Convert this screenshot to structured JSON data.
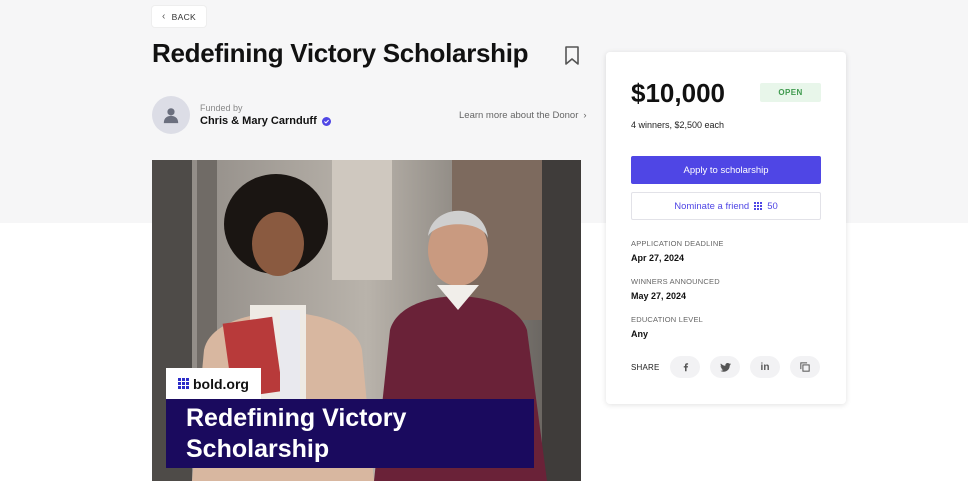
{
  "nav": {
    "back_label": "BACK"
  },
  "header": {
    "title": "Redefining Victory Scholarship"
  },
  "donor": {
    "funded_by_label": "Funded by",
    "name": "Chris & Mary Carnduff",
    "learn_more_label": "Learn more about the Donor"
  },
  "hero": {
    "brand": "bold.org",
    "caption_line1": "Redefining Victory",
    "caption_line2": "Scholarship"
  },
  "card": {
    "amount": "$10,000",
    "status": "OPEN",
    "winners": "4 winners, $2,500 each",
    "apply_label": "Apply to scholarship",
    "nominate_label": "Nominate a friend",
    "nominate_count": "50",
    "deadline_label": "APPLICATION DEADLINE",
    "deadline_value": "Apr 27, 2024",
    "announced_label": "WINNERS ANNOUNCED",
    "announced_value": "May 27, 2024",
    "education_label": "EDUCATION LEVEL",
    "education_value": "Any",
    "share_label": "SHARE"
  },
  "colors": {
    "accent": "#4f46e5",
    "open_badge_bg": "#e8f6ea",
    "open_badge_text": "#3f9a4e",
    "caption_bg": "#1a0a5e"
  },
  "icons": [
    "chevron-left-icon",
    "bookmark-icon",
    "user-icon",
    "verified-icon",
    "chevron-right-icon",
    "grid-icon",
    "facebook-icon",
    "twitter-icon",
    "linkedin-icon",
    "copy-icon"
  ]
}
